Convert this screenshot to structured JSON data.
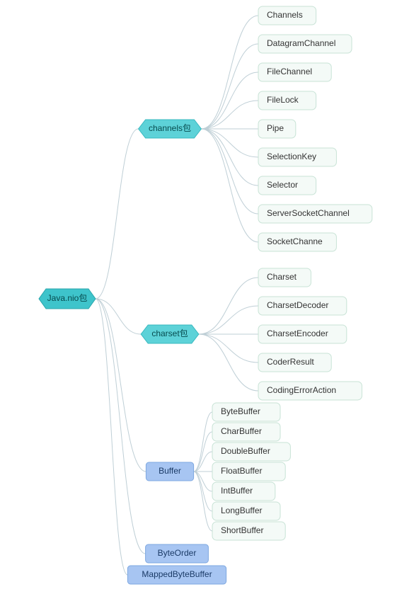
{
  "diagram": {
    "root": {
      "label": "Java.nio包"
    },
    "branches": [
      {
        "key": "channels",
        "label": "channels包",
        "nodeType": "hex",
        "children": [
          "Channels",
          "DatagramChannel",
          "FileChannel",
          "FileLock",
          "Pipe",
          "SelectionKey",
          "Selector",
          "ServerSocketChannel",
          "SocketChanne"
        ]
      },
      {
        "key": "charset",
        "label": "charset包",
        "nodeType": "hex",
        "children": [
          "Charset",
          "CharsetDecoder",
          "CharsetEncoder",
          "CoderResult",
          "CodingErrorAction"
        ]
      },
      {
        "key": "buffer",
        "label": "Buffer",
        "nodeType": "blue",
        "children": [
          "ByteBuffer",
          "CharBuffer",
          "DoubleBuffer",
          "FloatBuffer",
          "IntBuffer",
          "LongBuffer",
          "ShortBuffer"
        ]
      },
      {
        "key": "byteorder",
        "label": "ByteOrder",
        "nodeType": "blue",
        "children": []
      },
      {
        "key": "mapped",
        "label": "MappedByteBuffer",
        "nodeType": "blue",
        "children": []
      }
    ]
  }
}
